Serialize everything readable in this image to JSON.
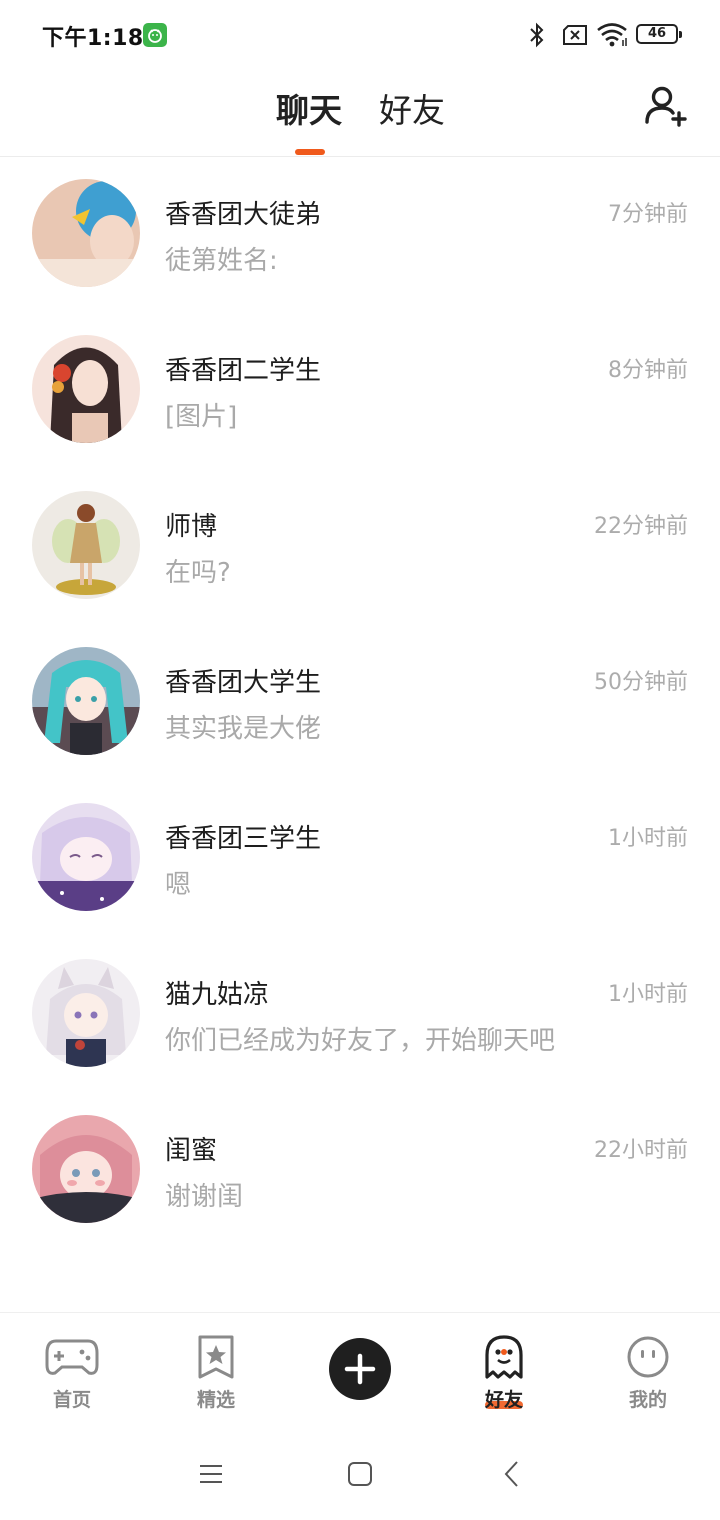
{
  "status_bar": {
    "time": "下午1:18",
    "battery": "46"
  },
  "header": {
    "tabs": [
      {
        "label": "聊天",
        "active": true
      },
      {
        "label": "好友",
        "active": false
      }
    ],
    "add_friend_icon": "add-user-icon"
  },
  "chats": [
    {
      "name": "香香团大徒弟",
      "preview": "徒第姓名:",
      "time": "7分钟前"
    },
    {
      "name": "香香团二学生",
      "preview": "[图片]",
      "time": "8分钟前"
    },
    {
      "name": "师博",
      "preview": "在吗?",
      "time": "22分钟前"
    },
    {
      "name": "香香团大学生",
      "preview": "其实我是大佬",
      "time": "50分钟前"
    },
    {
      "name": "香香团三学生",
      "preview": "嗯",
      "time": "1小时前"
    },
    {
      "name": "猫九姑凉",
      "preview": "你们已经成为好友了，开始聊天吧",
      "time": "1小时前"
    },
    {
      "name": "闺蜜",
      "preview": "谢谢闺",
      "time": "22小时前"
    }
  ],
  "bottom_nav": [
    {
      "label": "首页",
      "icon": "gamepad-icon",
      "active": false
    },
    {
      "label": "精选",
      "icon": "star-bookmark-icon",
      "active": false
    },
    {
      "label": "",
      "icon": "plus-icon",
      "active": false
    },
    {
      "label": "好友",
      "icon": "ghost-icon",
      "active": true
    },
    {
      "label": "我的",
      "icon": "face-icon",
      "active": false
    }
  ],
  "colors": {
    "accent": "#f05a1c",
    "text_primary": "#1e1e1e",
    "text_secondary": "#a9a9a9"
  }
}
